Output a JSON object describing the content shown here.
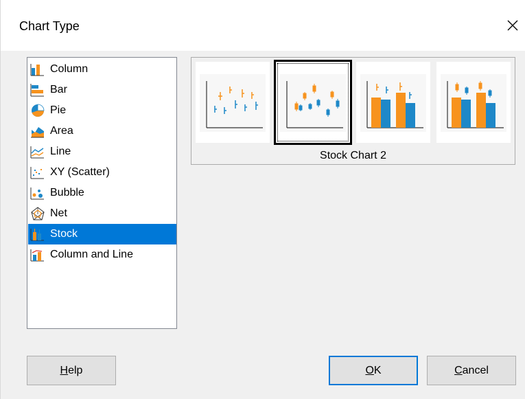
{
  "dialog": {
    "title": "Chart Type",
    "close_icon": "close-icon"
  },
  "chart_types": [
    {
      "label": "Column",
      "icon": "column-chart-icon"
    },
    {
      "label": "Bar",
      "icon": "bar-chart-icon"
    },
    {
      "label": "Pie",
      "icon": "pie-chart-icon"
    },
    {
      "label": "Area",
      "icon": "area-chart-icon"
    },
    {
      "label": "Line",
      "icon": "line-chart-icon"
    },
    {
      "label": "XY (Scatter)",
      "icon": "scatter-chart-icon"
    },
    {
      "label": "Bubble",
      "icon": "bubble-chart-icon"
    },
    {
      "label": "Net",
      "icon": "net-chart-icon"
    },
    {
      "label": "Stock",
      "icon": "stock-chart-icon",
      "selected": true
    },
    {
      "label": "Column and Line",
      "icon": "column-line-chart-icon"
    }
  ],
  "variants": {
    "selected_label": "Stock Chart 2",
    "selected_index": 1
  },
  "buttons": {
    "help": {
      "mnemonic": "H",
      "rest": "elp"
    },
    "ok": {
      "mnemonic": "O",
      "rest": "K"
    },
    "cancel": {
      "mnemonic": "C",
      "rest": "ancel"
    }
  },
  "colors": {
    "selection": "#0078d7",
    "orange": "#f7931e",
    "blue": "#1e88c8"
  }
}
